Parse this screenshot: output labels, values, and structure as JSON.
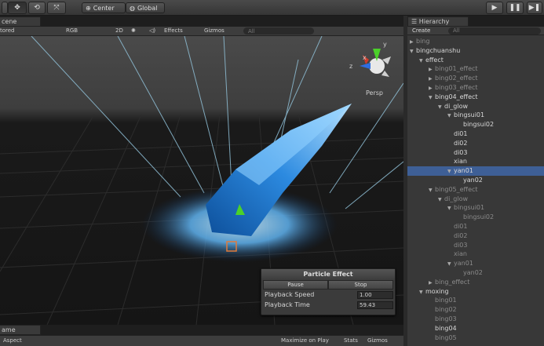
{
  "toolbar": {
    "tools": [
      "hand-icon",
      "move-icon",
      "rotate-icon",
      "scale-icon"
    ],
    "pivot_label": "Center",
    "space_label": "Global",
    "play_controls": [
      "play-icon",
      "pause-icon",
      "step-icon"
    ]
  },
  "scene": {
    "tab_label": "cene",
    "shading_mode": "tored",
    "render_mode": "RGB",
    "mode_2d": "2D",
    "effects_label": "Effects",
    "gizmos_label": "Gizmos",
    "search_placeholder": "All",
    "persp_label": "Persp",
    "axis_labels": {
      "x": "x",
      "y": "y",
      "z": "z"
    }
  },
  "particle_effect": {
    "title": "Particle Effect",
    "pause_label": "Pause",
    "stop_label": "Stop",
    "speed_label": "Playback Speed",
    "speed_value": "1.00",
    "time_label": "Playback Time",
    "time_value": "59.43"
  },
  "game": {
    "tab_label": "ame",
    "aspect_label": "Aspect",
    "maximize_label": "Maximize on Play",
    "stats_label": "Stats",
    "gizmos_label": "Gizmos"
  },
  "hierarchy": {
    "tab_label": "Hierarchy",
    "create_label": "Create",
    "search_placeholder": "All",
    "items": [
      {
        "label": "bing",
        "level": 0,
        "arrow": "right",
        "dim": true
      },
      {
        "label": "bingchuanshu",
        "level": 0,
        "arrow": "down",
        "dim": false
      },
      {
        "label": "effect",
        "level": 1,
        "arrow": "down",
        "dim": false
      },
      {
        "label": "bing01_effect",
        "level": 2,
        "arrow": "right",
        "dim": true
      },
      {
        "label": "bing02_effect",
        "level": 2,
        "arrow": "right",
        "dim": true
      },
      {
        "label": "bing03_effect",
        "level": 2,
        "arrow": "right",
        "dim": true
      },
      {
        "label": "bing04_effect",
        "level": 2,
        "arrow": "down",
        "dim": false
      },
      {
        "label": "di_glow",
        "level": 3,
        "arrow": "down",
        "dim": false
      },
      {
        "label": "bingsui01",
        "level": 4,
        "arrow": "down",
        "dim": false
      },
      {
        "label": "bingsui02",
        "level": 5,
        "arrow": "",
        "dim": false
      },
      {
        "label": "di01",
        "level": 4,
        "arrow": "",
        "dim": false
      },
      {
        "label": "di02",
        "level": 4,
        "arrow": "",
        "dim": false
      },
      {
        "label": "di03",
        "level": 4,
        "arrow": "",
        "dim": false
      },
      {
        "label": "xian",
        "level": 4,
        "arrow": "",
        "dim": false
      },
      {
        "label": "yan01",
        "level": 4,
        "arrow": "down",
        "dim": false,
        "selected": true
      },
      {
        "label": "yan02",
        "level": 5,
        "arrow": "",
        "dim": false
      },
      {
        "label": "bing05_effect",
        "level": 2,
        "arrow": "down",
        "dim": true
      },
      {
        "label": "di_glow",
        "level": 3,
        "arrow": "down",
        "dim": true
      },
      {
        "label": "bingsui01",
        "level": 4,
        "arrow": "down",
        "dim": true
      },
      {
        "label": "bingsui02",
        "level": 5,
        "arrow": "",
        "dim": true
      },
      {
        "label": "di01",
        "level": 4,
        "arrow": "",
        "dim": true
      },
      {
        "label": "di02",
        "level": 4,
        "arrow": "",
        "dim": true
      },
      {
        "label": "di03",
        "level": 4,
        "arrow": "",
        "dim": true
      },
      {
        "label": "xian",
        "level": 4,
        "arrow": "",
        "dim": true
      },
      {
        "label": "yan01",
        "level": 4,
        "arrow": "down",
        "dim": true
      },
      {
        "label": "yan02",
        "level": 5,
        "arrow": "",
        "dim": true
      },
      {
        "label": "bing_effect",
        "level": 2,
        "arrow": "right",
        "dim": true
      },
      {
        "label": "moxing",
        "level": 1,
        "arrow": "down",
        "dim": false
      },
      {
        "label": "bing01",
        "level": 2,
        "arrow": "",
        "dim": true
      },
      {
        "label": "bing02",
        "level": 2,
        "arrow": "",
        "dim": true
      },
      {
        "label": "bing03",
        "level": 2,
        "arrow": "",
        "dim": true
      },
      {
        "label": "bing04",
        "level": 2,
        "arrow": "",
        "dim": false
      },
      {
        "label": "bing05",
        "level": 2,
        "arrow": "",
        "dim": true
      }
    ]
  }
}
